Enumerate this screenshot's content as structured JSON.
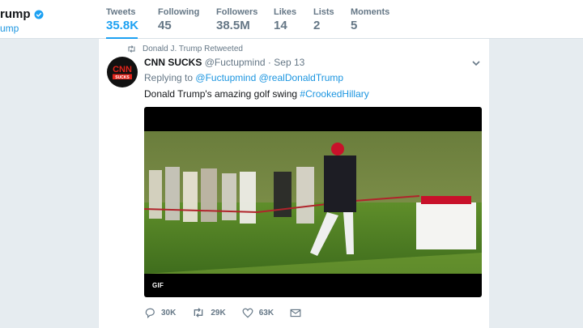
{
  "profile": {
    "name": "rump",
    "handle": "ump"
  },
  "stats": [
    {
      "label": "Tweets",
      "value": "35.8K"
    },
    {
      "label": "Following",
      "value": "45"
    },
    {
      "label": "Followers",
      "value": "38.5M"
    },
    {
      "label": "Likes",
      "value": "14"
    },
    {
      "label": "Lists",
      "value": "2"
    },
    {
      "label": "Moments",
      "value": "5"
    }
  ],
  "tweet": {
    "retweet_context": "Donald J. Trump Retweeted",
    "author_name": "CNN SUCKS",
    "author_handle": "@Fuctupmind",
    "separator": "·",
    "date": "Sep 13",
    "replying_prefix": "Replying to",
    "reply_to_1": "@Fuctupmind",
    "reply_to_2": "@realDonaldTrump",
    "text": "Donald Trump's amazing golf swing",
    "hashtag": "#CrookedHillary",
    "avatar_logo": "CNN SUCKS",
    "gif_badge": "GIF"
  },
  "actions": {
    "replies": "30K",
    "retweets": "29K",
    "likes": "63K"
  },
  "icons": [
    "verified-badge-icon",
    "retweet-icon",
    "chevron-down-icon",
    "reply-icon",
    "like-icon",
    "message-icon"
  ],
  "colors": {
    "accent": "#1da1f2",
    "link": "#1b95e0",
    "background": "#e6ecf0",
    "text": "#14171a",
    "muted": "#657786"
  }
}
